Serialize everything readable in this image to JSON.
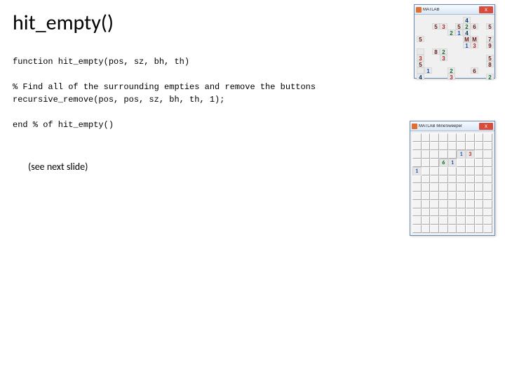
{
  "title": "hit_empty()",
  "code": {
    "l1": "function hit_empty(pos, sz, bh, th)",
    "l2": "",
    "l3": "% Find all of the surrounding empties and remove the buttons",
    "l4": "recursive_remove(pos, pos, sz, bh, th, 1);",
    "l5": "",
    "l6": "end % of hit_empty()"
  },
  "note": "(see next slide)",
  "thumb_top": {
    "title": "MATLAB",
    "close": "X",
    "cells": [
      {
        "row": 0,
        "col": 6,
        "v": "4",
        "cls": "d"
      },
      {
        "row": 1,
        "col": 2,
        "v": "5",
        "cls": "m"
      },
      {
        "row": 1,
        "col": 3,
        "v": "3",
        "cls": "r"
      },
      {
        "row": 1,
        "col": 5,
        "v": "5",
        "cls": "m"
      },
      {
        "row": 1,
        "col": 6,
        "v": "2",
        "cls": "g"
      },
      {
        "row": 1,
        "col": 7,
        "v": "6",
        "cls": "m"
      },
      {
        "row": 1,
        "col": 9,
        "v": "5",
        "cls": "m"
      },
      {
        "row": 2,
        "col": 4,
        "v": "2",
        "cls": "g"
      },
      {
        "row": 2,
        "col": 5,
        "v": "1"
      },
      {
        "row": 2,
        "col": 6,
        "v": "4",
        "cls": "d"
      },
      {
        "row": 3,
        "col": 0,
        "v": "5",
        "cls": "m"
      },
      {
        "row": 3,
        "col": 6,
        "v": "M",
        "cls": "m"
      },
      {
        "row": 3,
        "col": 7,
        "v": "M",
        "cls": "m"
      },
      {
        "row": 3,
        "col": 9,
        "v": "7",
        "cls": "m"
      },
      {
        "row": 4,
        "col": 6,
        "v": "1"
      },
      {
        "row": 4,
        "col": 7,
        "v": "3",
        "cls": "r"
      },
      {
        "row": 4,
        "col": 9,
        "v": "9",
        "cls": "m"
      },
      {
        "row": 5,
        "col": 0,
        "v": ""
      },
      {
        "row": 5,
        "col": 2,
        "v": "8",
        "cls": "m"
      },
      {
        "row": 5,
        "col": 3,
        "v": "2",
        "cls": "g"
      },
      {
        "row": 6,
        "col": 0,
        "v": "3",
        "cls": "r"
      },
      {
        "row": 6,
        "col": 3,
        "v": "3",
        "cls": "r"
      },
      {
        "row": 6,
        "col": 9,
        "v": "5",
        "cls": "m"
      },
      {
        "row": 7,
        "col": 0,
        "v": "5",
        "cls": "m"
      },
      {
        "row": 7,
        "col": 9,
        "v": "8",
        "cls": "m"
      },
      {
        "row": 8,
        "col": 0,
        "v": ""
      },
      {
        "row": 8,
        "col": 1,
        "v": "1"
      },
      {
        "row": 8,
        "col": 4,
        "v": "2",
        "cls": "g"
      },
      {
        "row": 8,
        "col": 7,
        "v": "6",
        "cls": "m"
      },
      {
        "row": 9,
        "col": 0,
        "v": "4",
        "cls": "d"
      },
      {
        "row": 9,
        "col": 4,
        "v": "3",
        "cls": "r"
      },
      {
        "row": 9,
        "col": 9,
        "v": "2",
        "cls": "g"
      }
    ]
  },
  "thumb_bottom": {
    "title": "MATLAB MineSweeper",
    "close": "X",
    "revealed": [
      {
        "row": 2,
        "col": 5,
        "v": "1",
        "cls": "b"
      },
      {
        "row": 2,
        "col": 6,
        "v": "3",
        "cls": "r"
      },
      {
        "row": 3,
        "col": 3,
        "v": "6",
        "cls": "g"
      },
      {
        "row": 3,
        "col": 4,
        "v": "1",
        "cls": "b"
      },
      {
        "row": 4,
        "col": 0,
        "v": "1",
        "cls": "b"
      }
    ]
  }
}
